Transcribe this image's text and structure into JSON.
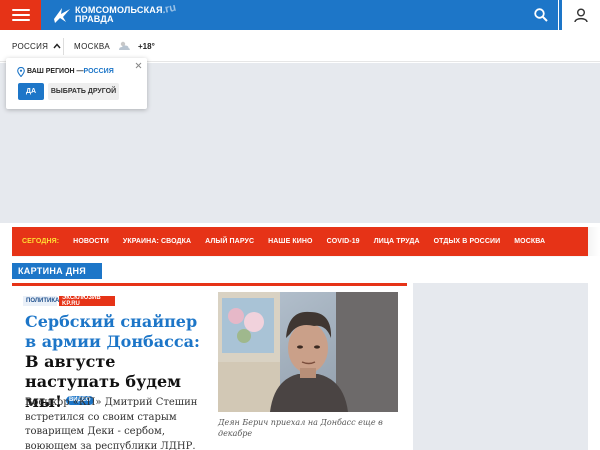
{
  "header": {
    "logo_text": "КОМСОМОЛЬСКАЯ ПРАВДА",
    "logo_ru": ".ru",
    "brand_color": "#1d76c8",
    "accent_color": "#e63317",
    "icons": [
      "menu-icon",
      "search-icon",
      "user-icon"
    ]
  },
  "subheader": {
    "region": "РОССИЯ",
    "city": "МОСКВА",
    "temperature": "+18°",
    "weather_icon": "cloud-sun-icon"
  },
  "region_popup": {
    "question": "ВАШ РЕГИОН —",
    "region": "РОССИЯ",
    "yes_label": "ДА",
    "other_label": "ВЫБРАТЬ ДРУГОЙ"
  },
  "nav": {
    "today_label": "СЕГОДНЯ:",
    "items": [
      "НОВОСТИ",
      "УКРАИНА: СВОДКА",
      "АЛЫЙ ПАРУС",
      "НАШЕ КИНО",
      "COVID-19",
      "ЛИЦА ТРУДА",
      "ОТДЫХ В РОССИИ",
      "МОСКВА"
    ]
  },
  "section": {
    "title": "КАРТИНА ДНЯ"
  },
  "article": {
    "tags": [
      "ПОЛИТИКА",
      "ЭКСКЛЮЗИВ KP.RU"
    ],
    "headline_part1": "Сербский снайпер в армии Донбасса:",
    "headline_part2": " В августе наступать будем мы!",
    "video_badge": "ВИДЕО",
    "lead": "Военкор «КП» Дмитрий Стешин встретился со своим старым товарищем Деки - сербом, воюющем за республики ЛДНР. Он",
    "photo_caption": "Деян Берич приехал на Донбасс еще в декабре"
  }
}
